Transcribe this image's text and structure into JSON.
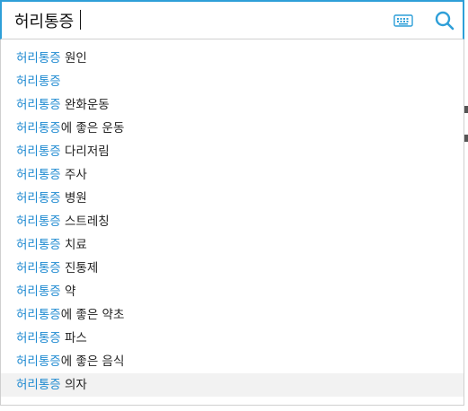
{
  "search": {
    "query": "허리통증"
  },
  "colors": {
    "accent": "#2e9fd8",
    "highlight": "#1f8ad1",
    "hover_bg": "#f2f2f2"
  },
  "icons": {
    "keyboard": "keyboard-icon",
    "search": "search-icon"
  },
  "suggestions": [
    {
      "match": "허리통증",
      "rest": " 원인"
    },
    {
      "match": "허리통증",
      "rest": ""
    },
    {
      "match": "허리통증",
      "rest": " 완화운동"
    },
    {
      "match": "허리통증",
      "rest": "에 좋은 운동"
    },
    {
      "match": "허리통증",
      "rest": " 다리저림"
    },
    {
      "match": "허리통증",
      "rest": " 주사"
    },
    {
      "match": "허리통증",
      "rest": " 병원"
    },
    {
      "match": "허리통증",
      "rest": " 스트레칭"
    },
    {
      "match": "허리통증",
      "rest": " 치료"
    },
    {
      "match": "허리통증",
      "rest": " 진통제"
    },
    {
      "match": "허리통증",
      "rest": " 약"
    },
    {
      "match": "허리통증",
      "rest": "에 좋은 약초"
    },
    {
      "match": "허리통증",
      "rest": " 파스"
    },
    {
      "match": "허리통증",
      "rest": "에 좋은 음식"
    },
    {
      "match": "허리통증",
      "rest": " 의자"
    }
  ],
  "hovered_index": 14
}
